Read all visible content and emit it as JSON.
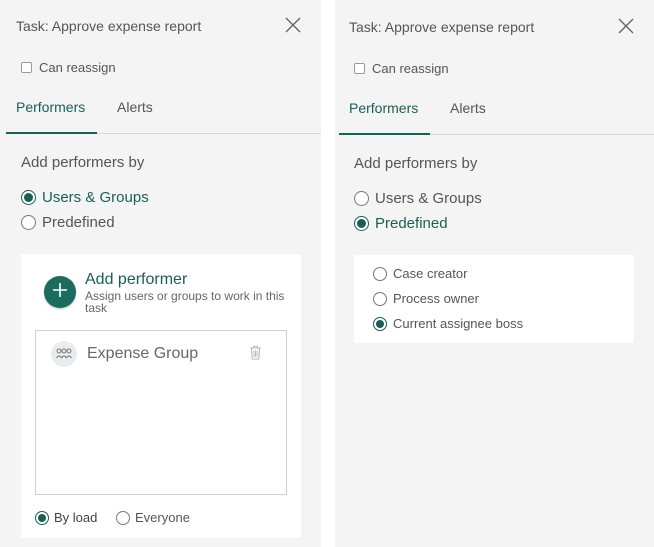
{
  "left": {
    "title": "Task: Approve expense report",
    "can_reassign": "Can reassign",
    "tabs": [
      {
        "label": "Performers"
      },
      {
        "label": "Alerts"
      }
    ],
    "add_by_label": "Add performers by",
    "options": [
      {
        "label": "Users & Groups",
        "checked": true
      },
      {
        "label": "Predefined",
        "checked": false
      }
    ],
    "add_performer": {
      "title": "Add performer",
      "subtitle": "Assign users or groups to work in this task"
    },
    "performers": [
      {
        "name": "Expense Group"
      }
    ],
    "modes": [
      {
        "label": "By load",
        "checked": true
      },
      {
        "label": "Everyone",
        "checked": false
      }
    ]
  },
  "right": {
    "title": "Task: Approve expense report",
    "can_reassign": "Can reassign",
    "tabs": [
      {
        "label": "Performers"
      },
      {
        "label": "Alerts"
      }
    ],
    "add_by_label": "Add performers by",
    "options": [
      {
        "label": "Users & Groups",
        "checked": false
      },
      {
        "label": "Predefined",
        "checked": true
      }
    ],
    "predefined": [
      {
        "label": "Case creator",
        "checked": false
      },
      {
        "label": "Process owner",
        "checked": false
      },
      {
        "label": "Current assignee boss",
        "checked": true
      }
    ]
  },
  "colors": {
    "accent": "#1b5e55",
    "panel_bg": "#f4f4f4"
  },
  "icons": {
    "close": "close-icon",
    "add": "plus-icon",
    "group": "group-icon",
    "delete": "trash-icon"
  }
}
